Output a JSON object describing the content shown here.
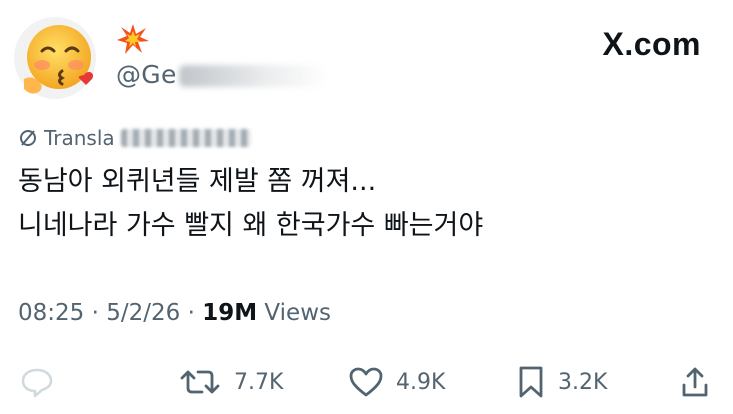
{
  "brand": {
    "label": "X.com"
  },
  "author": {
    "avatar_icon": "face-blowing-kiss-emoji",
    "display_name_icon": "collision-emoji",
    "handle_visible": "@Ge"
  },
  "translate": {
    "label": "Transla",
    "icon": "translate-icon"
  },
  "tweet": {
    "lines": [
      "동남아 외퀴년들 제발 쫌 꺼져...",
      "니네나라 가수 빨지 왜 한국가수 빠는거야"
    ]
  },
  "meta": {
    "time": "08:25",
    "sep1": " · ",
    "date": "5/2/26",
    "sep2": " · ",
    "views_count": "19M",
    "views_label": " Views"
  },
  "actions": {
    "reply": {
      "icon": "reply-icon"
    },
    "repost": {
      "icon": "repost-icon",
      "count": "7.7K"
    },
    "like": {
      "icon": "heart-icon",
      "count": "4.9K"
    },
    "bookmark": {
      "icon": "bookmark-icon",
      "count": "3.2K"
    },
    "share": {
      "icon": "share-icon"
    }
  }
}
